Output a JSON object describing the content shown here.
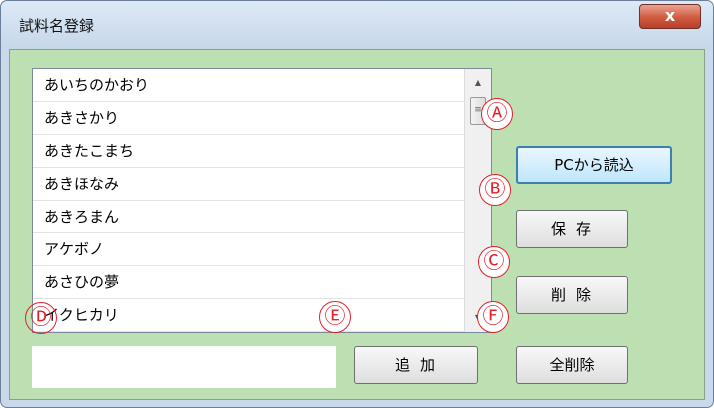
{
  "window": {
    "title": "試料名登録",
    "close_label": "x"
  },
  "listbox": {
    "items": [
      "あいちのかおり",
      "あきさかり",
      "あきたこまち",
      "あきほなみ",
      "あきろまん",
      "アケボノ",
      "あさひの夢",
      "イクヒカリ"
    ],
    "scroll_up_glyph": "▲",
    "scroll_down_glyph": "▼",
    "thumb_grip": "≡"
  },
  "input": {
    "value": ""
  },
  "buttons": {
    "load_pc": "PCから読込",
    "save": "保存",
    "delete": "削除",
    "add": "追加",
    "delete_all": "全削除"
  },
  "markers": {
    "a": "Ⓐ",
    "b": "Ⓑ",
    "c": "Ⓒ",
    "d": "Ⓓ",
    "e": "Ⓔ",
    "f": "Ⓕ"
  },
  "colors": {
    "client_background": "#bde0b3",
    "marker_red": "#e2202a",
    "close_button": "#cf5a3e"
  }
}
